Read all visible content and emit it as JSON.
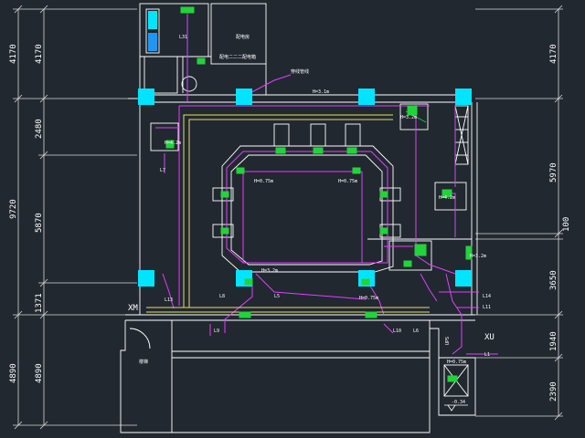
{
  "colors": {
    "background": "#212830",
    "wall": "#ffffff",
    "column": "#00e5ff",
    "pipe_magenta": "#e040fb",
    "pipe_yellow": "#e6e05a",
    "device_green": "#22d33a",
    "dim_line": "#d9d9d9"
  },
  "left_dims": {
    "outer": [
      "4170",
      "9720",
      "4890"
    ],
    "inner": [
      "4170",
      "2480",
      "5870",
      "1371",
      "4890"
    ]
  },
  "right_dims": {
    "outer": [
      "4170",
      "5970",
      "100",
      "3650",
      "1940",
      "2390"
    ]
  },
  "labels": {
    "grid_xm": "XM",
    "grid_xu": "XU",
    "level_bottom": "-0.34",
    "room_top": "配电房",
    "room_note": "配电二二二配电箱",
    "pipe_note": "穿线管线",
    "elev_top": "H=3.1m",
    "elev_1": "H=0.75m",
    "elev_2": "H=0.75m",
    "elev_3": "H=4.2m",
    "elev_4": "H=3.2m",
    "elev_5": "H=4.2m",
    "elev_6": "H=3.2m",
    "elev_7": "H=0.75m",
    "elev_8": "H=3.2m",
    "elev_9": "H=0.75m",
    "l1": "L1",
    "l5": "L5",
    "l6": "L6",
    "l7": "L7",
    "l8": "L8",
    "l9": "L9",
    "l10": "L10",
    "l11": "L11",
    "l13": "L13",
    "l14": "L14",
    "l31": "L31",
    "ups": "UPS",
    "stair": "楼梯"
  }
}
